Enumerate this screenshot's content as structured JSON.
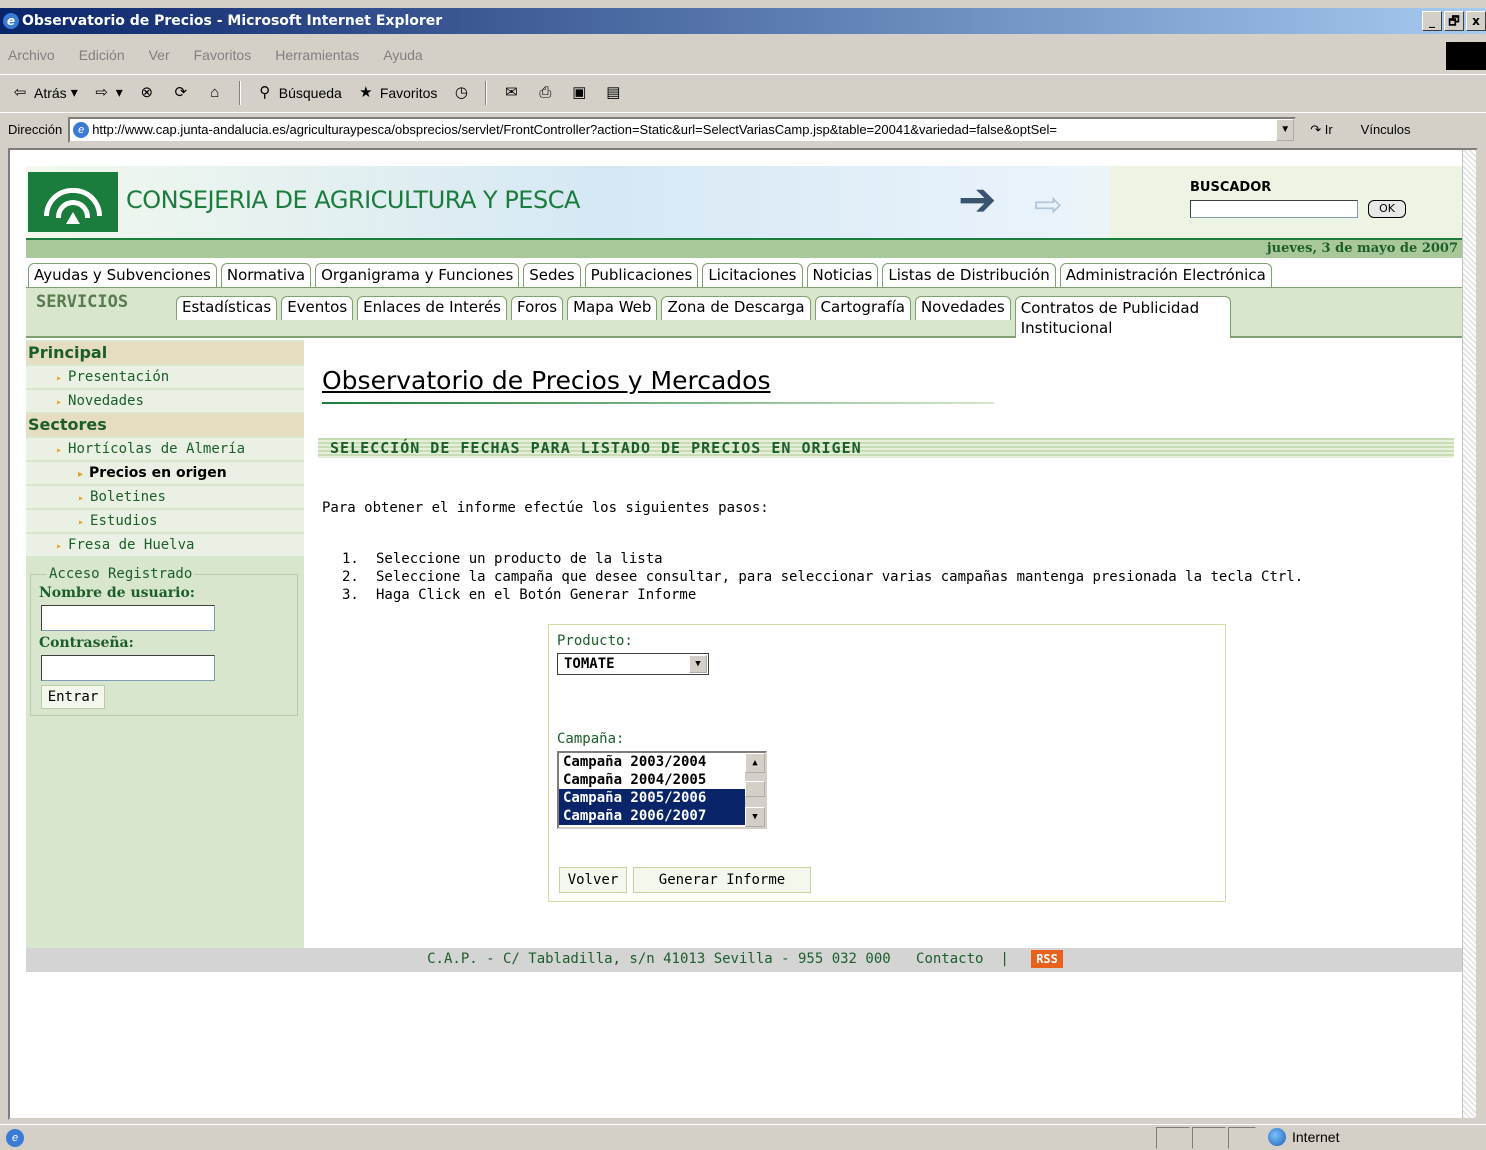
{
  "window": {
    "title": "Observatorio de Precios - Microsoft Internet Explorer",
    "controls": [
      "_",
      "🗗",
      "x"
    ]
  },
  "menu": [
    "Archivo",
    "Edición",
    "Ver",
    "Favoritos",
    "Herramientas",
    "Ayuda"
  ],
  "toolbar": {
    "back": "Atrás",
    "search": "Búsqueda",
    "favorites": "Favoritos"
  },
  "address": {
    "label": "Dirección",
    "url": "http://www.cap.junta-andalucia.es/agriculturaypesca/obsprecios/servlet/FrontController?action=Static&url=SelectVariasCamp.jsp&table=20041&variedad=false&optSel=",
    "go": "Ir",
    "links": "Vínculos"
  },
  "header": {
    "site_title": "CONSEJERIA DE AGRICULTURA Y PESCA",
    "search_label": "BUSCADOR",
    "search_button": "OK",
    "date": "jueves, 3 de mayo de 2007"
  },
  "nav_main": [
    "Ayudas y Subvenciones",
    "Normativa",
    "Organigrama y Funciones",
    "Sedes",
    "Publicaciones",
    "Licitaciones",
    "Noticias",
    "Listas de Distribución",
    "Administración Electrónica"
  ],
  "nav_services": {
    "label": "SERVICIOS",
    "items": [
      "Estadísticas",
      "Eventos",
      "Enlaces de Interés",
      "Foros",
      "Mapa Web",
      "Zona de Descarga",
      "Cartografía",
      "Novedades",
      "Contratos de Publicidad Institucional"
    ]
  },
  "sidebar": {
    "principal_heading": "Principal",
    "principal_items": [
      "Presentación",
      "Novedades"
    ],
    "sectores_heading": "Sectores",
    "sector_items": {
      "horticolas": "Hortícolas de Almería",
      "precios": "Precios en origen",
      "boletines": "Boletines",
      "estudios": "Estudios",
      "fresa": "Fresa de Huelva"
    },
    "login": {
      "legend": "Acceso Registrado",
      "user_label": "Nombre de usuario:",
      "password_label": "Contraseña:",
      "submit": "Entrar"
    }
  },
  "main": {
    "title": "Observatorio de Precios y Mercados",
    "section_title": "SELECCIÓN DE FECHAS PARA LISTADO DE PRECIOS EN ORIGEN",
    "intro": "Para obtener el informe efectúe los siguientes pasos:",
    "steps": [
      "Seleccione un producto de la lista",
      "Seleccione la campaña que desee consultar, para seleccionar varias campañas mantenga presionada la tecla Ctrl.",
      "Haga Click en el Botón Generar Informe"
    ],
    "form": {
      "product_label": "Producto:",
      "product_value": "TOMATE",
      "campaign_label": "Campaña:",
      "campaigns": [
        "Campaña 2003/2004",
        "Campaña 2004/2005",
        "Campaña 2005/2006",
        "Campaña 2006/2007"
      ],
      "selected_campaigns": [
        "Campaña 2005/2006",
        "Campaña 2006/2007"
      ],
      "back_button": "Volver",
      "generate_button": "Generar Informe"
    }
  },
  "footer": {
    "address": "C.A.P. - C/ Tabladilla, s/n 41013 Sevilla - 955 032 000",
    "contact": "Contacto",
    "separator": "|",
    "rss": "RSS"
  },
  "status": {
    "zone": "Internet"
  }
}
